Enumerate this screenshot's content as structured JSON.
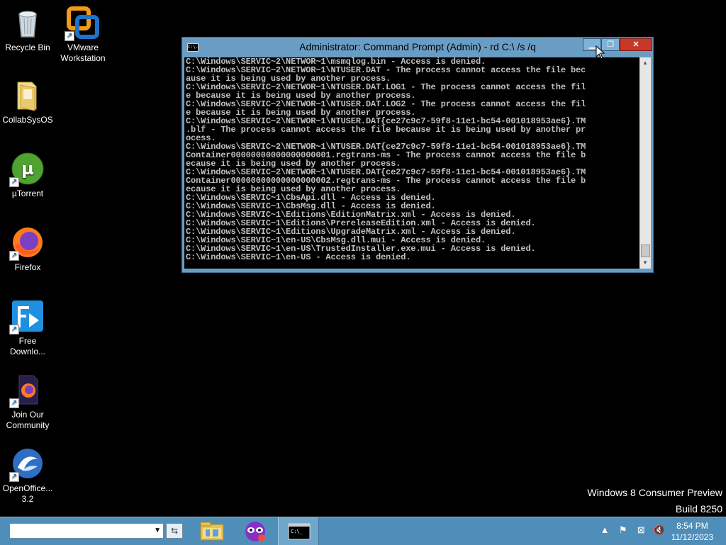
{
  "desktop": {
    "icons": [
      {
        "label": "Recycle Bin",
        "icon": "recycle-bin-icon"
      },
      {
        "label": "VMware Workstation",
        "icon": "vmware-icon"
      },
      {
        "label": "CollabSysOS",
        "icon": "folder-icon"
      },
      {
        "label": "µTorrent",
        "icon": "utorrent-icon"
      },
      {
        "label": "Firefox",
        "icon": "firefox-icon"
      },
      {
        "label": "Free Downlo...",
        "icon": "free-download-manager-icon"
      },
      {
        "label": "Join Our Community",
        "icon": "firefox-document-icon"
      },
      {
        "label": "OpenOffice... 3.2",
        "icon": "openoffice-icon"
      }
    ]
  },
  "cmd_window": {
    "title": "Administrator: Command Prompt (Admin) - rd  C:\\ /s /q",
    "sysicon_text": "C:\\.",
    "lines": [
      "C:\\Windows\\SERVIC~2\\NETWOR~1\\msmqlog.bin - Access is denied.",
      "C:\\Windows\\SERVIC~2\\NETWOR~1\\NTUSER.DAT - The process cannot access the file bec",
      "ause it is being used by another process.",
      "C:\\Windows\\SERVIC~2\\NETWOR~1\\NTUSER.DAT.LOG1 - The process cannot access the fil",
      "e because it is being used by another process.",
      "C:\\Windows\\SERVIC~2\\NETWOR~1\\NTUSER.DAT.LOG2 - The process cannot access the fil",
      "e because it is being used by another process.",
      "C:\\Windows\\SERVIC~2\\NETWOR~1\\NTUSER.DAT{ce27c9c7-59f8-11e1-bc54-001018953ae6}.TM",
      ".blf - The process cannot access the file because it is being used by another pr",
      "ocess.",
      "C:\\Windows\\SERVIC~2\\NETWOR~1\\NTUSER.DAT{ce27c9c7-59f8-11e1-bc54-001018953ae6}.TM",
      "Container00000000000000000001.regtrans-ms - The process cannot access the file b",
      "ecause it is being used by another process.",
      "C:\\Windows\\SERVIC~2\\NETWOR~1\\NTUSER.DAT{ce27c9c7-59f8-11e1-bc54-001018953ae6}.TM",
      "Container00000000000000000002.regtrans-ms - The process cannot access the file b",
      "ecause it is being used by another process.",
      "C:\\Windows\\SERVIC~1\\CbsApi.dll - Access is denied.",
      "C:\\Windows\\SERVIC~1\\CbsMsg.dll - Access is denied.",
      "C:\\Windows\\SERVIC~1\\Editions\\EditionMatrix.xml - Access is denied.",
      "C:\\Windows\\SERVIC~1\\Editions\\PrereleaseEdition.xml - Access is denied.",
      "C:\\Windows\\SERVIC~1\\Editions\\UpgradeMatrix.xml - Access is denied.",
      "C:\\Windows\\SERVIC~1\\en-US\\CbsMsg.dll.mui - Access is denied.",
      "C:\\Windows\\SERVIC~1\\en-US\\TrustedInstaller.exe.mui - Access is denied.",
      "C:\\Windows\\SERVIC~1\\en-US - Access is denied."
    ]
  },
  "watermark": {
    "line1": "Windows 8 Consumer Preview",
    "line2": "Build 8250"
  },
  "taskbar": {
    "address_value": "",
    "apps": [
      {
        "name": "file-explorer-icon"
      },
      {
        "name": "app-mask-icon"
      },
      {
        "name": "command-prompt-icon",
        "active": true
      }
    ],
    "tray_icons": [
      "chevron-up-icon",
      "action-center-flag-icon",
      "network-error-icon",
      "volume-muted-icon"
    ],
    "clock_time": "8:54 PM",
    "clock_date": "11/12/2023"
  },
  "colors": {
    "taskbar": "#4f8eb8",
    "window_frame": "#6a9dc4",
    "close_button": "#c7372a",
    "console_text": "#c0c0c0"
  }
}
